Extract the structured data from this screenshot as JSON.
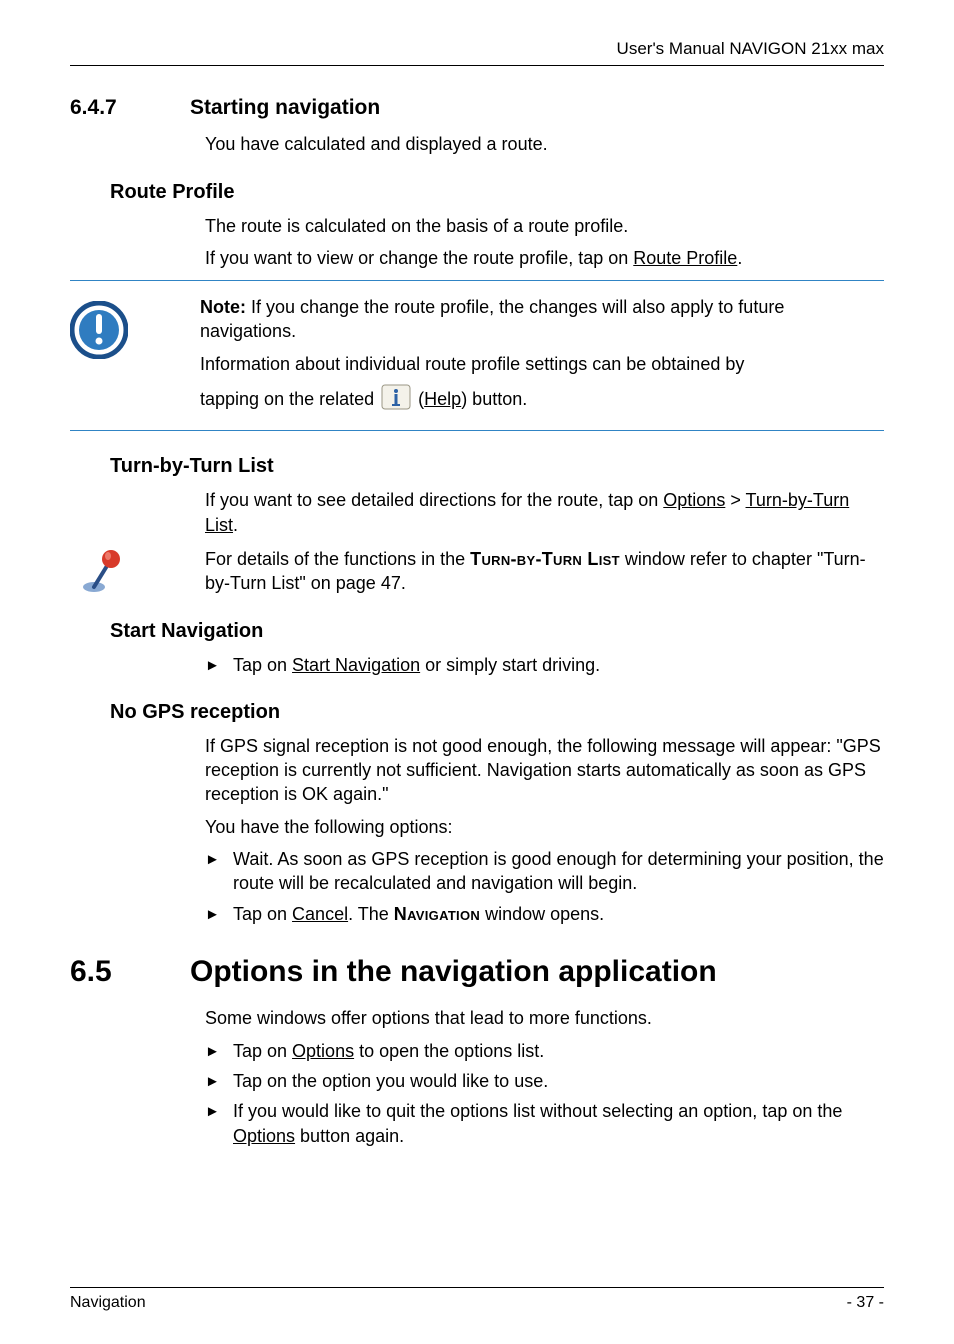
{
  "header": {
    "right": "User's Manual NAVIGON 21xx max"
  },
  "s647": {
    "num": "6.4.7",
    "title": "Starting navigation",
    "intro": "You have calculated and displayed a route."
  },
  "routeProfile": {
    "heading": "Route Profile",
    "p1": "The route is calculated on the basis of a route profile.",
    "p2_pre": "If you want to view or change the route profile, tap on ",
    "p2_link": "Route Profile",
    "p2_post": "."
  },
  "note": {
    "bold": "Note:",
    "l1": " If you change the route profile, the changes will also apply to future navigations.",
    "l2": "Information about individual route profile settings can be obtained by ",
    "l3_pre": "tapping on the related ",
    "l3_help": "Help",
    "l3_post": ") button."
  },
  "tbt": {
    "heading": "Turn-by-Turn List",
    "p1_pre": "If you want to see detailed directions for the route, tap on ",
    "p1_link1": "Options",
    "p1_mid": " > ",
    "p1_link2": "Turn-by-Turn List",
    "p1_post": ".",
    "tip_pre": "For details of the functions in the ",
    "tip_sc": "Turn-by-Turn List",
    "tip_post": " window refer to chapter \"Turn-by-Turn List\" on page 47."
  },
  "startNav": {
    "heading": "Start Navigation",
    "b_pre": "Tap on ",
    "b_link": "Start Navigation",
    "b_post": " or simply start driving."
  },
  "noGps": {
    "heading": "No GPS reception",
    "p1": "If GPS signal reception is not good enough, the following message will appear: \"GPS reception is currently not sufficient. Navigation starts automatically as soon as GPS reception is OK again.\"",
    "p2": "You have the following options:",
    "b1": "Wait. As soon as GPS reception is good enough for determining your position, the route will be recalculated and navigation will begin.",
    "b2_pre": "Tap on ",
    "b2_link": "Cancel",
    "b2_mid": ". The ",
    "b2_sc": "Navigation",
    "b2_post": " window opens."
  },
  "s65": {
    "num": "6.5",
    "title": "Options in the navigation application",
    "p1": "Some windows offer options that lead to more functions.",
    "b1_pre": "Tap on ",
    "b1_link": "Options",
    "b1_post": " to open the options list.",
    "b2": "Tap on the option you would like to use.",
    "b3_pre": "If you would like to quit the options list without selecting an option, tap on the ",
    "b3_link": "Options",
    "b3_post": " button again."
  },
  "footer": {
    "left": "Navigation",
    "right": "- 37 -"
  }
}
